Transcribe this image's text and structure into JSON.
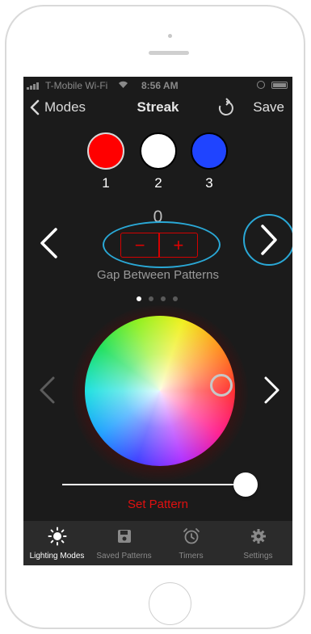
{
  "status_bar": {
    "carrier": "T-Mobile Wi-Fi",
    "time": "8:56 AM"
  },
  "nav": {
    "back_label": "Modes",
    "title": "Streak",
    "save_label": "Save"
  },
  "color_slots": [
    {
      "label": "1",
      "color": "#ff0000"
    },
    {
      "label": "2",
      "color": "#ffffff"
    },
    {
      "label": "3",
      "color": "#1f44ff"
    }
  ],
  "gap": {
    "value": "0",
    "minus_label": "−",
    "plus_label": "+",
    "caption": "Gap Between Patterns"
  },
  "page_indicator": {
    "total": 4,
    "active": 1
  },
  "colors": {
    "accent_red": "#e01010",
    "highlight_blue": "#2aa8d6",
    "background": "#1b1b1b"
  },
  "brightness_slider": {
    "value": 1.0
  },
  "set_pattern_label": "Set Pattern",
  "tabs": [
    {
      "label": "Lighting Modes",
      "icon": "sun-icon",
      "active": true
    },
    {
      "label": "Saved Patterns",
      "icon": "floppy-disk-icon",
      "active": false
    },
    {
      "label": "Timers",
      "icon": "alarm-clock-icon",
      "active": false
    },
    {
      "label": "Settings",
      "icon": "gear-icon",
      "active": false
    }
  ]
}
